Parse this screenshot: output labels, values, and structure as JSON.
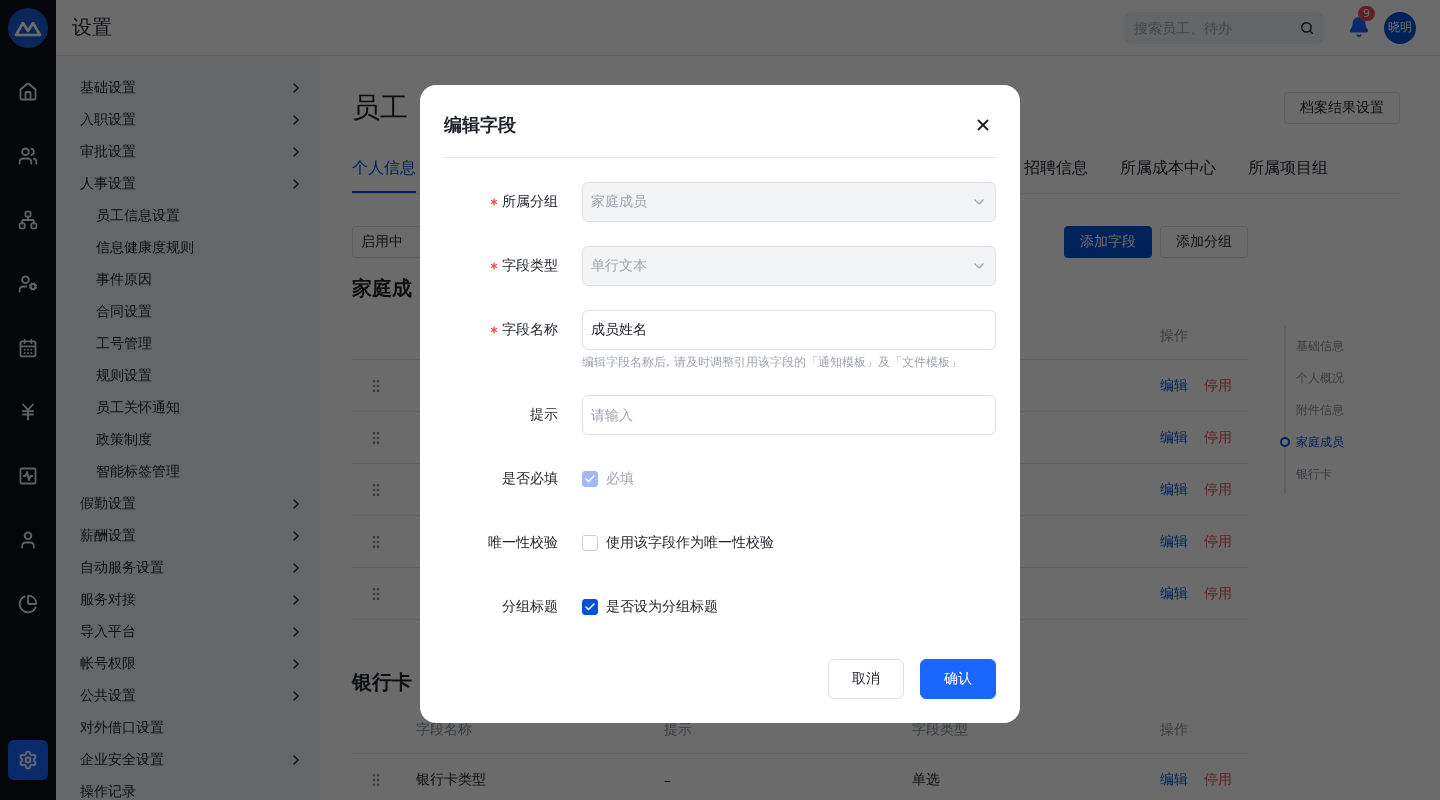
{
  "header": {
    "title": "设置",
    "search": {
      "placeholder": "搜索员工、待办"
    },
    "notifications": {
      "count": "9"
    },
    "user": {
      "avatar": "晓明"
    }
  },
  "rail": [
    {
      "kind": "home",
      "selected": false
    },
    {
      "kind": "people",
      "selected": false
    },
    {
      "kind": "org",
      "selected": false
    },
    {
      "kind": "user-settings",
      "selected": false
    },
    {
      "kind": "calendar",
      "selected": false
    },
    {
      "kind": "money",
      "selected": false
    },
    {
      "kind": "report",
      "selected": false
    },
    {
      "kind": "person",
      "selected": false
    },
    {
      "kind": "pie",
      "selected": false
    },
    {
      "kind": "settings",
      "selected": true
    }
  ],
  "menu": [
    {
      "label": "基础设置",
      "arrow": true
    },
    {
      "label": "入职设置",
      "arrow": true
    },
    {
      "label": "审批设置",
      "arrow": true
    },
    {
      "label": "人事设置",
      "arrow": true,
      "children": [
        {
          "label": "员工信息设置"
        },
        {
          "label": "信息健康度规则"
        },
        {
          "label": "事件原因"
        },
        {
          "label": "合同设置"
        },
        {
          "label": "工号管理"
        },
        {
          "label": "规则设置"
        },
        {
          "label": "员工关怀通知"
        },
        {
          "label": "政策制度"
        },
        {
          "label": "智能标签管理"
        }
      ]
    },
    {
      "label": "假勤设置",
      "arrow": true
    },
    {
      "label": "薪酬设置",
      "arrow": true
    },
    {
      "label": "自动服务设置",
      "arrow": true
    },
    {
      "label": "服务对接",
      "arrow": true
    },
    {
      "label": "导入平台",
      "arrow": true
    },
    {
      "label": "帐号权限",
      "arrow": true
    },
    {
      "label": "公共设置",
      "arrow": true
    },
    {
      "label": "对外借口设置",
      "arrow": false
    },
    {
      "label": "企业安全设置",
      "arrow": true
    },
    {
      "label": "操作记录",
      "arrow": false
    }
  ],
  "page": {
    "title": "员工",
    "results_button": "档案结果设置",
    "tabs": [
      {
        "label": "个人信息",
        "selected": true
      },
      {
        "label": "招聘信息",
        "selected": false
      },
      {
        "label": "所属成本中心",
        "selected": false
      },
      {
        "label": "所属项目组",
        "selected": false
      }
    ],
    "status_filter": "启用中",
    "add_field_button": "添加字段",
    "add_group_button": "添加分组",
    "sections": [
      {
        "title": "家庭成",
        "columns": {
          "actions": "操作"
        },
        "rows": [
          {
            "edit": "编辑",
            "disable": "停用"
          },
          {
            "edit": "编辑",
            "disable": "停用"
          },
          {
            "edit": "编辑",
            "disable": "停用"
          },
          {
            "edit": "编辑",
            "disable": "停用"
          },
          {
            "edit": "编辑",
            "disable": "停用"
          }
        ]
      },
      {
        "title": "银行卡",
        "columns": {
          "name": "字段名称",
          "hint": "提示",
          "type": "字段类型",
          "actions": "操作"
        },
        "rows": [
          {
            "name": "银行卡类型",
            "hint": "–",
            "type": "单选",
            "edit": "编辑",
            "disable": "停用"
          }
        ]
      }
    ],
    "anchors": [
      {
        "label": "基础信息",
        "selected": false
      },
      {
        "label": "个人概况",
        "selected": false
      },
      {
        "label": "附件信息",
        "selected": false
      },
      {
        "label": "家庭成员",
        "selected": true
      },
      {
        "label": "银行卡",
        "selected": false
      }
    ]
  },
  "dialog": {
    "title": "编辑字段",
    "fields": [
      {
        "kind": "select",
        "label": "所属分组",
        "required": true,
        "value": "家庭成员",
        "disabled": true
      },
      {
        "kind": "select",
        "label": "字段类型",
        "required": true,
        "value": "单行文本",
        "disabled": true
      },
      {
        "kind": "text",
        "label": "字段名称",
        "required": true,
        "value": "成员姓名",
        "help": "编辑字段名称后, 请及时调整引用该字段的「通知模板」及「文件模板」"
      },
      {
        "kind": "text",
        "label": "提示",
        "required": false,
        "placeholder": "请输入"
      },
      {
        "kind": "checkbox",
        "label": "是否必填",
        "option": "必填",
        "checked": true,
        "disabled": true
      },
      {
        "kind": "checkbox",
        "label": "唯一性校验",
        "option": "使用该字段作为唯一性校验",
        "checked": false,
        "disabled": false
      },
      {
        "kind": "checkbox",
        "label": "分组标题",
        "option": "是否设为分组标题",
        "checked": true,
        "disabled": false
      }
    ],
    "cancel": "取消",
    "confirm": "确认"
  }
}
